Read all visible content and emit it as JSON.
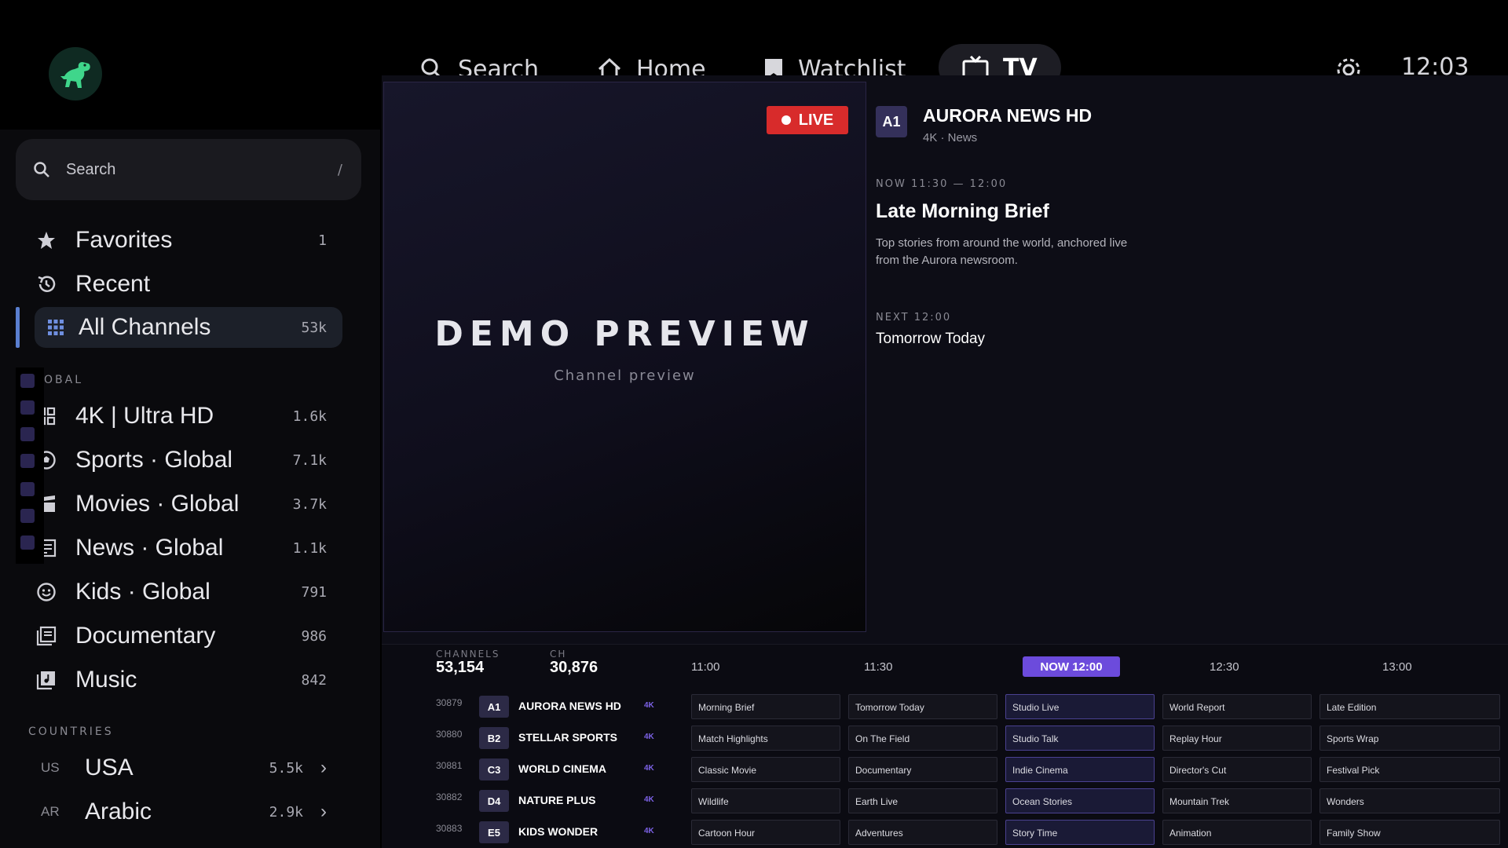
{
  "nav": {
    "items": [
      {
        "label": "Search",
        "icon": "search-icon"
      },
      {
        "label": "Home",
        "icon": "home-icon"
      },
      {
        "label": "Watchlist",
        "icon": "bookmark-icon"
      },
      {
        "label": "TV",
        "icon": "tv-icon",
        "active": true
      }
    ],
    "clock": "12:03",
    "settings_icon": "gear-icon"
  },
  "sidebar": {
    "search": {
      "label": "Search",
      "shortcut": "/"
    },
    "items": [
      {
        "label": "Favorites",
        "count": "1",
        "icon": "star-icon"
      },
      {
        "label": "Recent",
        "count": "",
        "icon": "history-icon"
      },
      {
        "label": "All Channels",
        "count": "53k",
        "icon": "grid-icon",
        "active": true
      }
    ],
    "global_header": "OBAL",
    "global_items": [
      {
        "label": "4K | Ultra HD",
        "count": "1.6k",
        "icon": "tiles-icon"
      },
      {
        "label": "Sports · Global",
        "count": "7.1k",
        "icon": "soccer-ball-icon"
      },
      {
        "label": "Movies · Global",
        "count": "3.7k",
        "icon": "clapperboard-icon"
      },
      {
        "label": "News · Global",
        "count": "1.1k",
        "icon": "newspaper-icon"
      },
      {
        "label": "Kids · Global",
        "count": "791",
        "icon": "smiley-icon"
      },
      {
        "label": "Documentary",
        "count": "986",
        "icon": "library-icon"
      },
      {
        "label": "Music",
        "count": "842",
        "icon": "music-library-icon"
      }
    ],
    "countries_header": "COUNTRIES",
    "countries": [
      {
        "code": "US",
        "label": "USA",
        "count": "5.5k"
      },
      {
        "code": "AR",
        "label": "Arabic",
        "count": "2.9k"
      }
    ]
  },
  "preview": {
    "live_label": "LIVE",
    "title": "DEMO PREVIEW",
    "subtitle": "Channel preview"
  },
  "channel": {
    "badge": "A1",
    "name": "AURORA NEWS HD",
    "meta": "4K · News",
    "now_label": "NOW 11:30 — 12:00",
    "now_title": "Late Morning Brief",
    "now_desc": "Top stories from around the world, anchored live from the Aurora newsroom.",
    "next_label": "NEXT 12:00",
    "next_title": "Tomorrow Today"
  },
  "epg": {
    "channels_label": "CHANNELS",
    "channels_value": "53,154",
    "ch_label": "CH",
    "ch_value": "30,876",
    "times": [
      "11:00",
      "11:30",
      "NOW 12:00",
      "12:30",
      "13:00"
    ],
    "rows": [
      {
        "num": "30879",
        "badge": "A1",
        "name": "AURORA NEWS HD",
        "quality": "4K",
        "programs": [
          "Morning Brief",
          "Tomorrow Today",
          "Studio Live",
          "World Report",
          "Late Edition"
        ]
      },
      {
        "num": "30880",
        "badge": "B2",
        "name": "STELLAR SPORTS",
        "quality": "4K",
        "programs": [
          "Match Highlights",
          "On The Field",
          "Studio Talk",
          "Replay Hour",
          "Sports Wrap"
        ]
      },
      {
        "num": "30881",
        "badge": "C3",
        "name": "WORLD CINEMA",
        "quality": "4K",
        "programs": [
          "Classic Movie",
          "Documentary",
          "Indie Cinema",
          "Director's Cut",
          "Festival Pick"
        ]
      },
      {
        "num": "30882",
        "badge": "D4",
        "name": "NATURE PLUS",
        "quality": "4K",
        "programs": [
          "Wildlife",
          "Earth Live",
          "Ocean Stories",
          "Mountain Trek",
          "Wonders"
        ]
      },
      {
        "num": "30883",
        "badge": "E5",
        "name": "KIDS WONDER",
        "quality": "4K",
        "programs": [
          "Cartoon Hour",
          "Adventures",
          "Story Time",
          "Animation",
          "Family Show"
        ]
      }
    ]
  },
  "colors": {
    "accent": "#6c4bdc",
    "live": "#d82b2b",
    "active_bar": "#5a7fd0"
  }
}
